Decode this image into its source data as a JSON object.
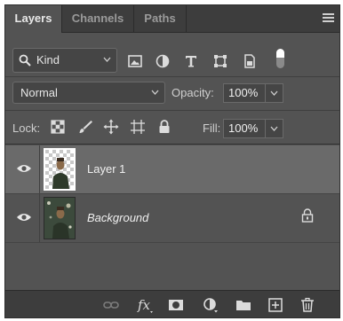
{
  "tabs": [
    {
      "label": "Layers",
      "active": true
    },
    {
      "label": "Channels",
      "active": false
    },
    {
      "label": "Paths",
      "active": false
    }
  ],
  "filter": {
    "kind_label": "Kind",
    "icons": [
      "image-filter-icon",
      "adjustment-filter-icon",
      "type-filter-icon",
      "shape-filter-icon",
      "smart-object-filter-icon"
    ]
  },
  "blend": {
    "mode": "Normal",
    "opacity_label": "Opacity:",
    "opacity_value": "100%"
  },
  "lock": {
    "label": "Lock:",
    "icons": [
      "lock-transparent-pixels-icon",
      "lock-image-pixels-icon",
      "lock-position-icon",
      "lock-artboard-icon",
      "lock-all-icon"
    ],
    "fill_label": "Fill:",
    "fill_value": "100%"
  },
  "layers": [
    {
      "name": "Layer 1",
      "selected": true,
      "visible": true,
      "locked": false
    },
    {
      "name": "Background",
      "selected": false,
      "visible": true,
      "locked": true
    }
  ],
  "bottom_icons": [
    "link-layers-icon",
    "fx-icon",
    "layer-mask-icon",
    "adjustment-layer-icon",
    "folder-icon",
    "new-layer-icon",
    "trash-icon"
  ],
  "colors": {
    "panel": "#535353",
    "tabbar": "#3d3d3d",
    "selected_row": "#6a6a6a"
  }
}
